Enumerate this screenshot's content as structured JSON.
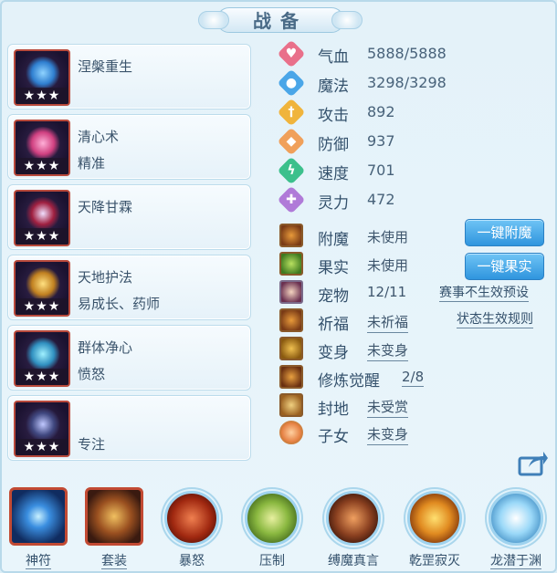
{
  "title": "战备",
  "skills": [
    {
      "name": "涅槃重生",
      "sub": "",
      "stars": "★★★",
      "icon": "phoenix-ring-icon",
      "color": "#3aa0e8"
    },
    {
      "name": "清心术",
      "sub": "精准",
      "stars": "★★★",
      "icon": "sword-pink-icon",
      "color": "#e05090"
    },
    {
      "name": "天降甘霖",
      "sub": "",
      "stars": "★★★",
      "icon": "warrior-mask-icon",
      "color": "#c03050"
    },
    {
      "name": "天地护法",
      "sub": "易成长、药师",
      "stars": "★★★",
      "icon": "golden-chain-icon",
      "color": "#d0a030"
    },
    {
      "name": "群体净心",
      "sub": "愤怒",
      "stars": "★★★",
      "icon": "eye-orb-icon",
      "color": "#40b0d8"
    },
    {
      "name": "",
      "sub": "专注",
      "stars": "★★★",
      "icon": "dark-mask-icon",
      "color": "#6070a0"
    }
  ],
  "stats": [
    {
      "label": "气血",
      "value": "5888/5888",
      "icon": "heart-icon",
      "color": "#e9708a",
      "glyph": "♥"
    },
    {
      "label": "魔法",
      "value": "3298/3298",
      "icon": "mana-drop-icon",
      "color": "#4aa6e8",
      "glyph": "●"
    },
    {
      "label": "攻击",
      "value": "892",
      "icon": "attack-sword-icon",
      "color": "#f0b43c",
      "glyph": "†"
    },
    {
      "label": "防御",
      "value": "937",
      "icon": "shield-icon",
      "color": "#f0a05a",
      "glyph": "◆"
    },
    {
      "label": "速度",
      "value": "701",
      "icon": "lightning-icon",
      "color": "#3cc08c",
      "glyph": "ϟ"
    },
    {
      "label": "灵力",
      "value": "472",
      "icon": "spirit-cross-icon",
      "color": "#b07ad8",
      "glyph": "✚"
    }
  ],
  "status": [
    {
      "label": "附魔",
      "value": "未使用",
      "underline": false,
      "icon": "enchant-icon"
    },
    {
      "label": "果实",
      "value": "未使用",
      "underline": false,
      "icon": "fruit-icon"
    },
    {
      "label": "宠物",
      "value": "12/11",
      "underline": false,
      "icon": "pet-portrait-icon"
    },
    {
      "label": "祈福",
      "value": "未祈福",
      "underline": true,
      "icon": "blessing-icon"
    },
    {
      "label": "变身",
      "value": "未变身",
      "underline": true,
      "icon": "transform-icon"
    },
    {
      "label": "修炼觉醒",
      "value": "2/8",
      "underline": true,
      "icon": "cultivation-icon"
    },
    {
      "label": "封地",
      "value": "未受赏",
      "underline": true,
      "icon": "fief-icon"
    },
    {
      "label": "子女",
      "value": "未变身",
      "underline": true,
      "icon": "children-icon"
    }
  ],
  "buttons": {
    "enchant": "一键附魔",
    "fruit": "一键果实"
  },
  "links": {
    "preset": "赛事不生效预设",
    "rules": "状态生效规则"
  },
  "bottom": [
    {
      "label": "神符",
      "frame": "square",
      "underline": true,
      "icon": "rune-icon",
      "color": "#4aa8f0"
    },
    {
      "label": "套装",
      "frame": "square",
      "underline": true,
      "icon": "armor-set-icon",
      "color": "#c08030"
    },
    {
      "label": "暴怒",
      "frame": "round",
      "underline": false,
      "icon": "rage-beast-icon",
      "color": "#c0502a"
    },
    {
      "label": "压制",
      "frame": "round",
      "underline": false,
      "icon": "suppress-icon",
      "color": "#8ab840"
    },
    {
      "label": "缚魔真言",
      "frame": "round",
      "underline": false,
      "icon": "bind-demon-icon",
      "color": "#b06030"
    },
    {
      "label": "乾罡寂灭",
      "frame": "round",
      "underline": false,
      "icon": "heaven-strike-icon",
      "color": "#e08a20"
    },
    {
      "label": "龙潜于渊",
      "frame": "round",
      "underline": true,
      "icon": "dragon-abyss-icon",
      "color": "#8ac8ee"
    }
  ]
}
